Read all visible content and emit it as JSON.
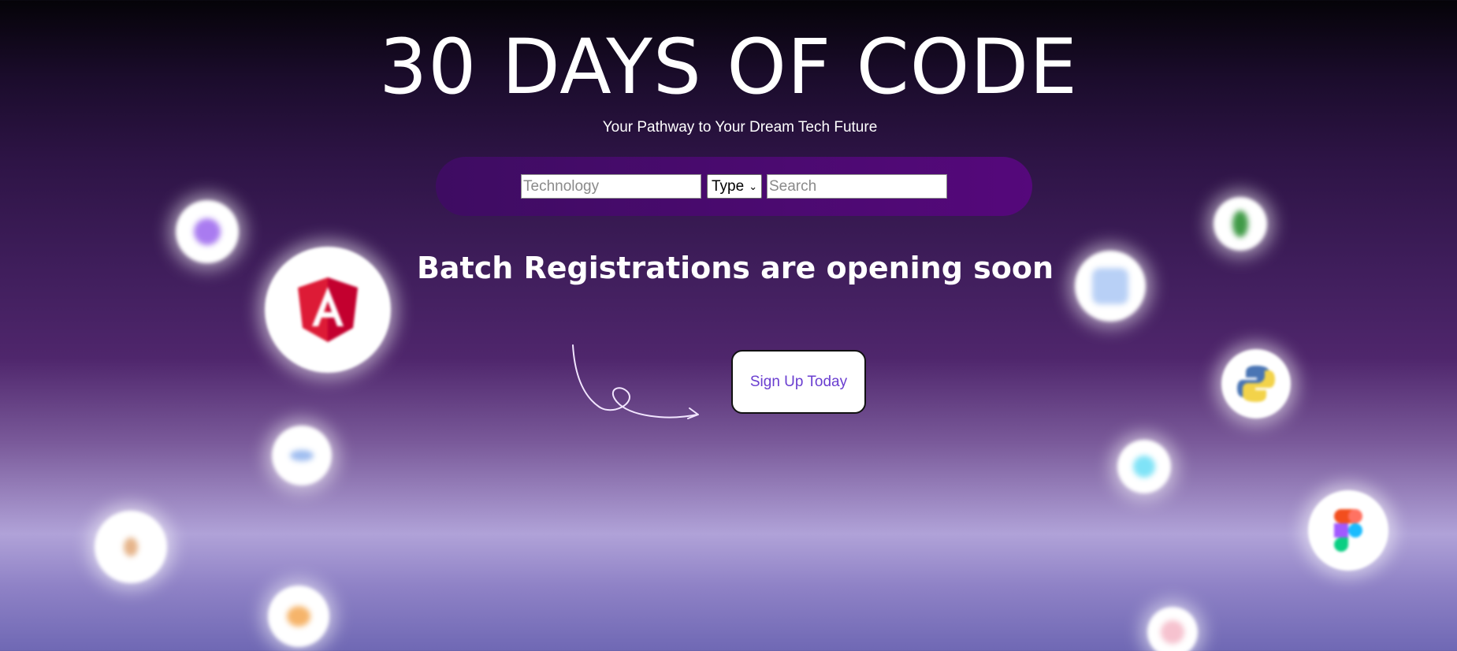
{
  "hero": {
    "title": "30 DAYS OF CODE",
    "subtitle": "Your Pathway to Your Dream Tech Future"
  },
  "search": {
    "technology_placeholder": "Technology",
    "type_value": "Type",
    "search_placeholder": "Search"
  },
  "announcement": "Batch Registrations are opening soon",
  "cta": {
    "label": "Sign Up Today"
  },
  "colors": {
    "search_bar": "#55087b",
    "cta_text": "#6a3ed0",
    "angular_red": "#dd1b36"
  },
  "tech_icons": [
    "purple-logo-icon",
    "angular-icon",
    "code-brackets-icon",
    "multicolor-logo-icon",
    "sketch-icon",
    "android-icon",
    "docs-icon",
    "python-icon",
    "react-icon",
    "figma-icon",
    "pink-logo-icon"
  ]
}
